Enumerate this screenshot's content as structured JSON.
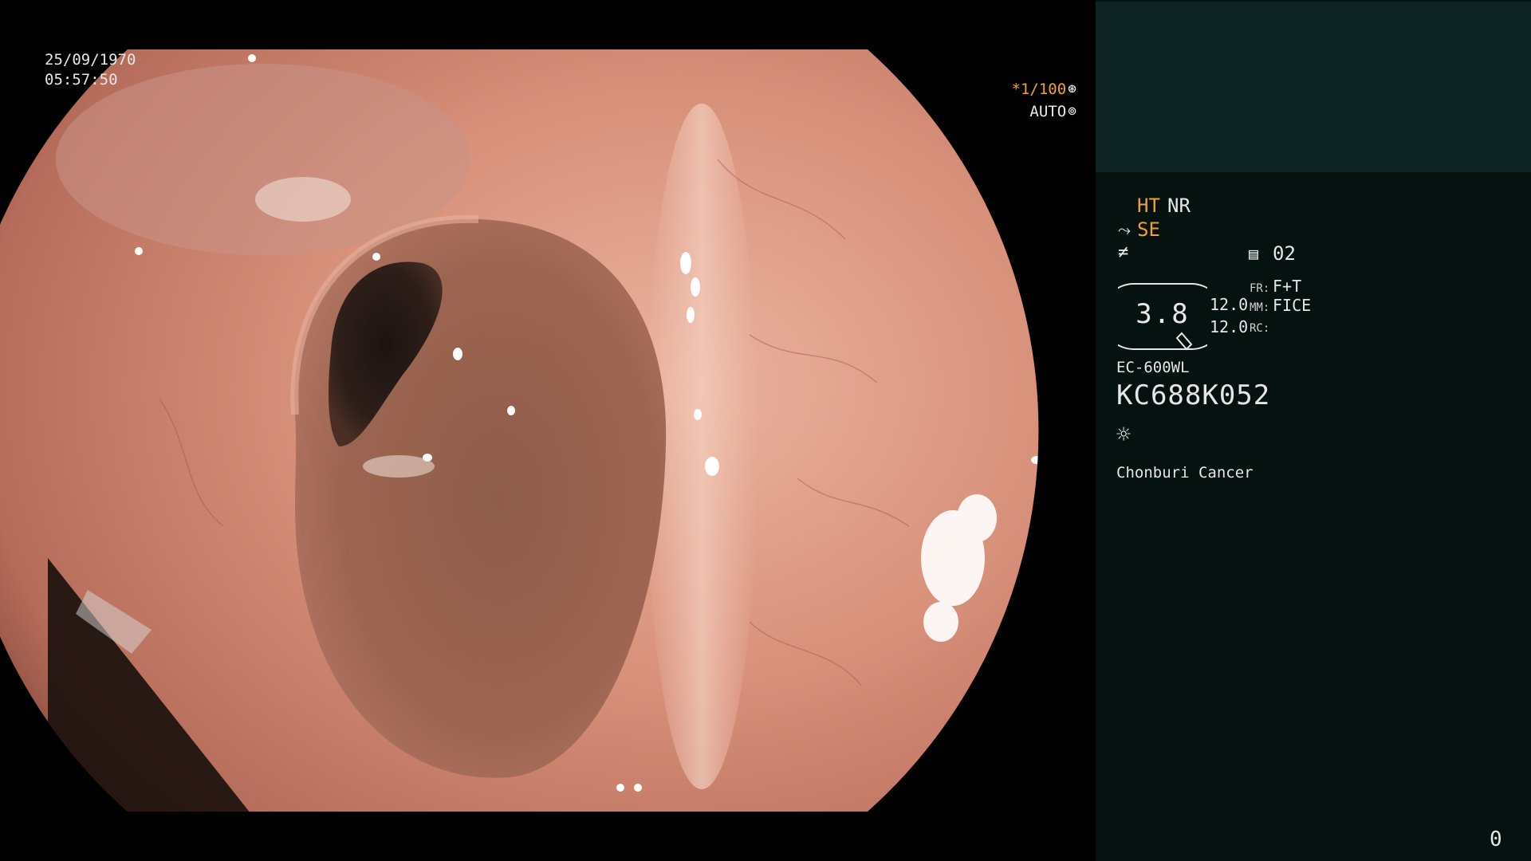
{
  "overlay": {
    "date": "25/09/1970",
    "time": "05:57:50",
    "shutter": "*1/100",
    "shutter_icon": "⊛",
    "mode": "AUTO",
    "mode_icon": "⊚"
  },
  "panel": {
    "ht": "HT",
    "nr": "NR",
    "se_icon": "⤳",
    "se": "SE",
    "f_icon": "≠",
    "rec_icon": "▤",
    "rec_num": "02",
    "zoom": "3.8",
    "val_top": "12.0",
    "val_bot": "12.0",
    "fr_label": "FR:",
    "fr_value": "F+T",
    "mm_label": "MM:",
    "mm_value": "FICE",
    "rc_label": "RC:",
    "model": "EC-600WL",
    "serial": "KC688K052",
    "light_icon": "☼",
    "hospital": "Chonburi Cancer",
    "counter": "0"
  },
  "colors": {
    "accent_orange": "#f0a030",
    "panel_bg": "#061210",
    "panel_header_bg": "#0d2324",
    "mucosa": "#c98a78"
  }
}
